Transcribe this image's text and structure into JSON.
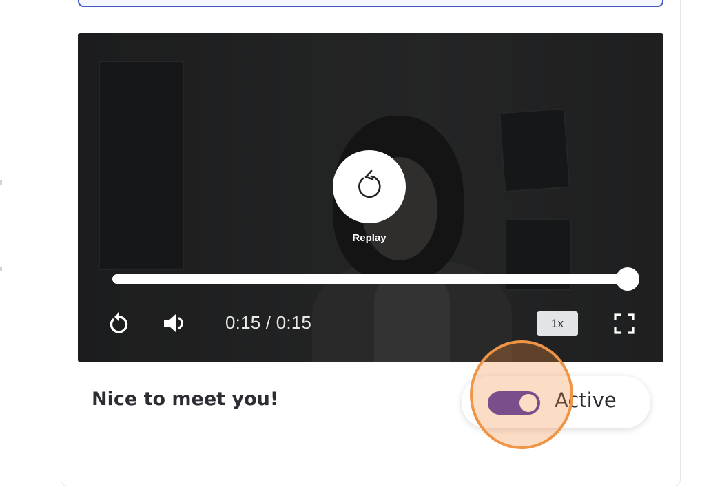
{
  "video": {
    "replay_label": "Replay",
    "current_time": "0:15",
    "separator": " / ",
    "duration": "0:15",
    "progress": 1.0,
    "speed": "1x",
    "icons": {
      "replay": "replay-icon",
      "rewind": "rewind-icon",
      "volume": "volume-icon",
      "fullscreen": "fullscreen-icon"
    }
  },
  "caption": "Nice to meet you!",
  "status": {
    "label": "Active",
    "enabled": true,
    "toggle_color": "#4436ad"
  },
  "colors": {
    "accent": "#4257c6",
    "highlight": "#f09545"
  }
}
